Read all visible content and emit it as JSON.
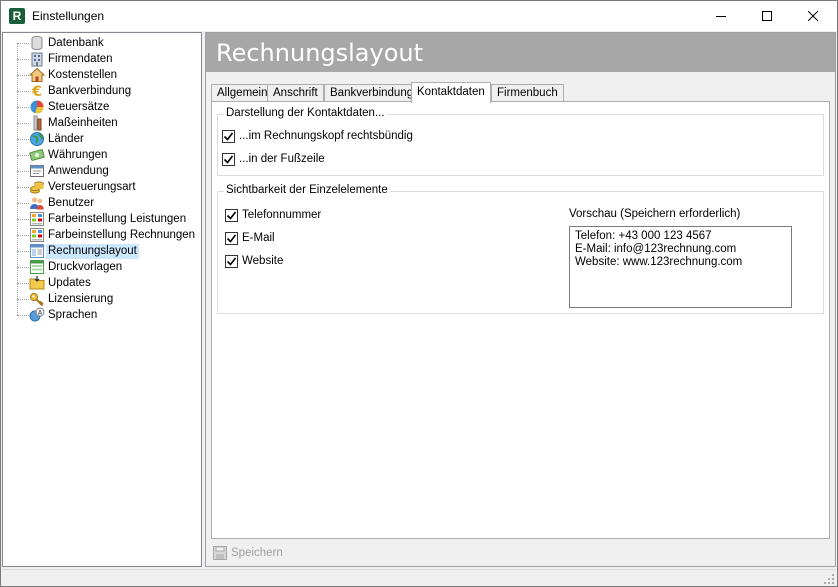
{
  "window": {
    "title": "Einstellungen",
    "app_icon_letter": "R"
  },
  "tree": {
    "items": [
      {
        "label": "Datenbank",
        "icon": "database-icon"
      },
      {
        "label": "Firmendaten",
        "icon": "building-icon"
      },
      {
        "label": "Kostenstellen",
        "icon": "house-icon"
      },
      {
        "label": "Bankverbindung",
        "icon": "euro-icon"
      },
      {
        "label": "Steuersätze",
        "icon": "pie-chart-icon"
      },
      {
        "label": "Maßeinheiten",
        "icon": "ruler-icon"
      },
      {
        "label": "Länder",
        "icon": "globe-icon"
      },
      {
        "label": "Währungen",
        "icon": "money-icon"
      },
      {
        "label": "Anwendung",
        "icon": "application-icon"
      },
      {
        "label": "Versteuerungsart",
        "icon": "coins-icon"
      },
      {
        "label": "Benutzer",
        "icon": "users-icon"
      },
      {
        "label": "Farbeinstellung Leistungen",
        "icon": "color-grid-icon"
      },
      {
        "label": "Farbeinstellung Rechnungen",
        "icon": "color-grid-icon"
      },
      {
        "label": "Rechnungslayout",
        "icon": "layout-icon",
        "selected": true
      },
      {
        "label": "Druckvorlagen",
        "icon": "template-icon"
      },
      {
        "label": "Updates",
        "icon": "update-folder-icon"
      },
      {
        "label": "Lizensierung",
        "icon": "key-icon"
      },
      {
        "label": "Sprachen",
        "icon": "language-icon"
      }
    ]
  },
  "header": {
    "title": "Rechnungslayout"
  },
  "tabs": [
    {
      "label": "Allgemein"
    },
    {
      "label": "Anschrift"
    },
    {
      "label": "Bankverbindung"
    },
    {
      "label": "Kontaktdaten",
      "active": true
    },
    {
      "label": "Firmenbuch"
    }
  ],
  "kontakt": {
    "group_title": "Darstellung der Kontaktdaten...",
    "options": [
      {
        "label": "...im Rechnungskopf rechtsbündig",
        "checked": true
      },
      {
        "label": "...in der Fußzeile",
        "checked": true
      }
    ]
  },
  "sichtbarkeit": {
    "group_title": "Sichtbarkeit der Einzelelemente",
    "options": [
      {
        "label": "Telefonnummer",
        "checked": true
      },
      {
        "label": "E-Mail",
        "checked": true
      },
      {
        "label": "Website",
        "checked": true
      }
    ],
    "preview_label": "Vorschau (Speichern erforderlich)",
    "preview_lines": [
      "Telefon: +43 000 123 4567",
      "E-Mail: info@123rechnung.com",
      "Website: www.123rechnung.com"
    ]
  },
  "footer": {
    "save_label": "Speichern"
  },
  "colors": {
    "header_bg": "#a7a7a7",
    "selection": "#cce8ff",
    "app_icon": "#1a5f3a"
  }
}
